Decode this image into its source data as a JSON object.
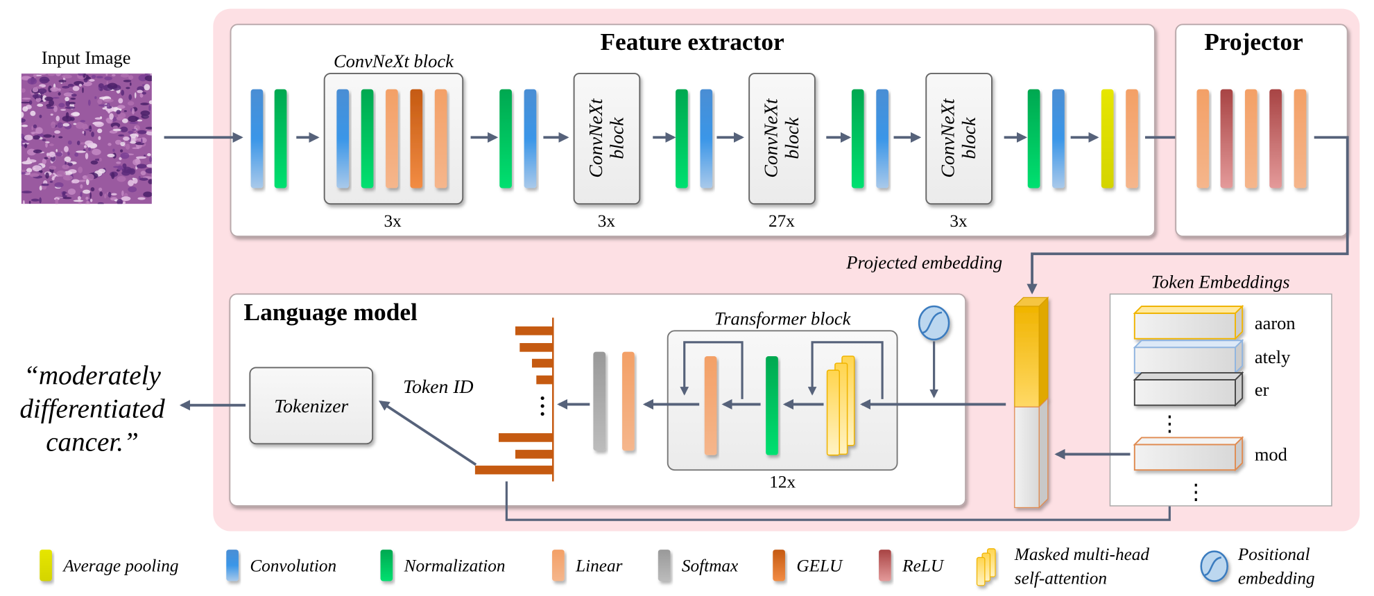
{
  "input": {
    "title": "Input Image"
  },
  "feature_extractor": {
    "title": "Feature extractor",
    "block_title": "ConvNeXt block",
    "block_label_line1": "ConvNeXt",
    "block_label_line2": "block",
    "repeats": [
      "3x",
      "3x",
      "27x",
      "3x"
    ]
  },
  "projector": {
    "title": "Projector",
    "output_label": "Projected embedding"
  },
  "token_embeddings": {
    "title": "Token Embeddings",
    "tokens": [
      "aaron",
      "ately",
      "er",
      "mod"
    ],
    "ellipsis": "⋮"
  },
  "language_model": {
    "title": "Language model",
    "transformer_title": "Transformer block",
    "transformer_repeats": "12x",
    "token_id_label": "Token ID",
    "tokenizer_label": "Tokenizer"
  },
  "output_text": {
    "line1": "“moderately",
    "line2": "differentiated",
    "line3": "cancer.”"
  },
  "legend": [
    {
      "label": "Average pooling",
      "color": "#e0e000"
    },
    {
      "label": "Convolution",
      "color": "#3a96e8"
    },
    {
      "label": "Normalization",
      "color": "#00c060"
    },
    {
      "label": "Linear",
      "color": "#f4a874"
    },
    {
      "label": "Softmax",
      "color": "#aaaaaa"
    },
    {
      "label": "GELU",
      "color": "#e07428"
    },
    {
      "label": "ReLU",
      "color": "#c86464"
    },
    {
      "label": "Masked multi-head",
      "label2": "self-attention",
      "color": "#ffd966"
    },
    {
      "label": "Positional",
      "label2": "embedding",
      "color": "#bcd7ef"
    }
  ],
  "colors": {
    "background_panel": "#fde0e4",
    "arrow": "#56627a",
    "histogram": "#c55a11"
  }
}
